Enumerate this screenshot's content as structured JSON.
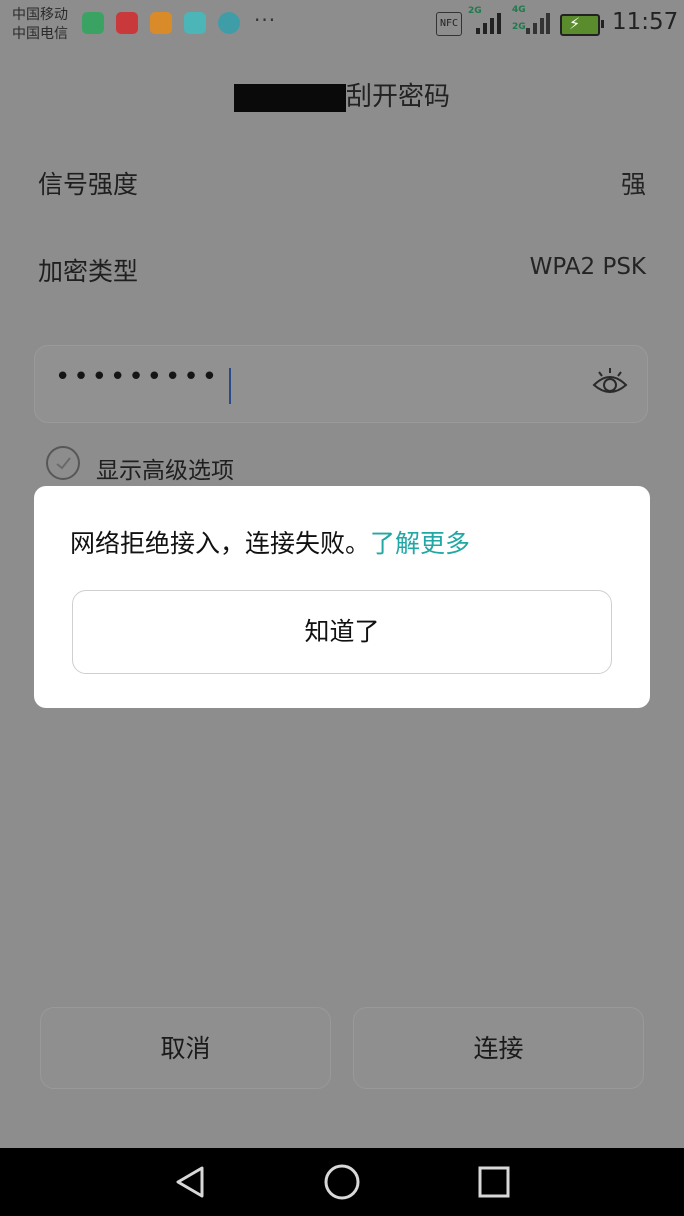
{
  "status_bar": {
    "carrier_1": "中国移动",
    "carrier_2": "中国电信",
    "more": "···",
    "nfc": "NFC",
    "net_1": "2G",
    "net_2": "4G",
    "net_3": "2G",
    "time": "11:57"
  },
  "header": {
    "title_suffix": "刮开密码"
  },
  "info": {
    "signal_label": "信号强度",
    "signal_value": "强",
    "encryption_label": "加密类型",
    "encryption_value": "WPA2 PSK"
  },
  "password": {
    "masked_value": "•••••••••"
  },
  "advanced": {
    "label": "显示高级选项",
    "checked": false
  },
  "dialog": {
    "message": "网络拒绝接入，连接失败。",
    "link": "了解更多",
    "ok_label": "知道了"
  },
  "buttons": {
    "cancel": "取消",
    "connect": "连接"
  },
  "colors": {
    "link": "#21a7a4",
    "dim_overlay": "#8d8d8d"
  }
}
